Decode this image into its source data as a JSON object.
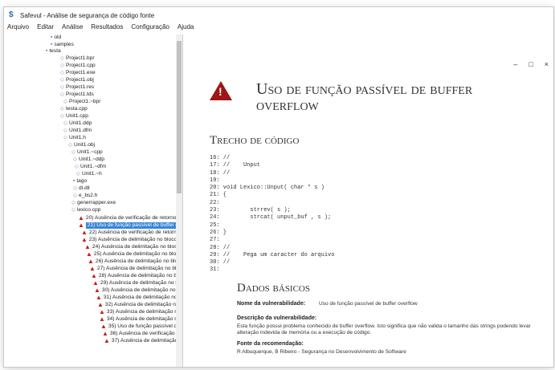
{
  "window": {
    "title": "Safevul - Análise de segurança de código fonte",
    "controls": {
      "minimize": "–",
      "maximize": "□",
      "close": "×"
    }
  },
  "menu": [
    "Arquivo",
    "Editar",
    "Análise",
    "Resultados",
    "Configuração",
    "Ajuda"
  ],
  "tree": [
    {
      "label": "old",
      "icon": "folder"
    },
    {
      "label": "samples",
      "icon": "folder"
    },
    {
      "label": "testa",
      "icon": "folder"
    },
    {
      "label": "Project1.bpr",
      "icon": "file"
    },
    {
      "label": "Project1.cpp",
      "icon": "file"
    },
    {
      "label": "Project1.exe",
      "icon": "file"
    },
    {
      "label": "Project1.obj",
      "icon": "file"
    },
    {
      "label": "Project1.res",
      "icon": "file"
    },
    {
      "label": "Project1.tds",
      "icon": "file"
    },
    {
      "label": "Project1.~bpr",
      "icon": "file"
    },
    {
      "label": "testa.cpp",
      "icon": "file"
    },
    {
      "label": "Unit1.cpp",
      "icon": "file"
    },
    {
      "label": "Unit1.ddp",
      "icon": "file"
    },
    {
      "label": "Unit1.dfm",
      "icon": "file"
    },
    {
      "label": "Unit1.h",
      "icon": "file"
    },
    {
      "label": "Unit1.obj",
      "icon": "file"
    },
    {
      "label": "Unit1.~cpp",
      "icon": "file"
    },
    {
      "label": "Unit1.~ddp",
      "icon": "file"
    },
    {
      "label": "Unit1.~dfm",
      "icon": "file"
    },
    {
      "label": "Unit1.~h",
      "icon": "file"
    },
    {
      "label": "tago",
      "icon": "folder"
    },
    {
      "label": "dl.dll",
      "icon": "file"
    },
    {
      "label": "e_bs2.h",
      "icon": "file"
    },
    {
      "label": "generrapper.exe",
      "icon": "file"
    },
    {
      "label": "lexico.cpp",
      "icon": "file"
    },
    {
      "label": "20) Ausência de verificação de retorno de função",
      "icon": "warn"
    },
    {
      "label": "21) Uso de função passível de buffer overflow",
      "icon": "warn",
      "selected": true
    },
    {
      "label": "22) Ausência de verificação de retorno de função",
      "icon": "warn"
    },
    {
      "label": "23) Ausência de delimitação no bloco de código",
      "icon": "warn"
    },
    {
      "label": "24) Ausência de delimitação no bloco de código",
      "icon": "warn"
    },
    {
      "label": "25) Ausência de delimitação no bloco de código",
      "icon": "warn"
    },
    {
      "label": "26) Ausência de delimitação no bloco de código",
      "icon": "warn"
    },
    {
      "label": "27) Ausência de delimitação no bloco de código",
      "icon": "warn"
    },
    {
      "label": "28) Ausência de delimitação no bloco de código",
      "icon": "warn"
    },
    {
      "label": "29) Ausência de delimitação no bloco de código",
      "icon": "warn"
    },
    {
      "label": "30) Ausência de delimitação no bloco de código",
      "icon": "warn"
    },
    {
      "label": "31) Ausência de delimitação no bloco de código",
      "icon": "warn"
    },
    {
      "label": "32) Ausência de delimitação no bloco de código",
      "icon": "warn"
    },
    {
      "label": "33) Ausência de delimitação no bloco de código",
      "icon": "warn"
    },
    {
      "label": "34) Ausência de delimitação no bloco de código",
      "icon": "warn"
    },
    {
      "label": "35) Uso de função passível de buffer overflow",
      "icon": "warn"
    },
    {
      "label": "36) Ausência de verificação de retorno de função",
      "icon": "warn"
    },
    {
      "label": "37) Ausência de delimitação no bloco de código",
      "icon": "warn"
    }
  ],
  "detail": {
    "title": "Uso de função passível de buffer overflow",
    "code_heading": "Trecho de código",
    "code": "16: //\n17: //    Unput\n18: //\n19:\n20: void Lexico::Unput( char * s )\n21: {\n22:\n23:         strrev( s );\n24:         strcat( unput_buf , s );\n25:\n26: }\n27:\n28: //\n29: //    Pega um caracter do arquivo\n30: //\n31:",
    "basic_heading": "Dados básicos",
    "name_label": "Nome da vulnerabilidade:",
    "name_value": "Uso de função passível de buffer overflow",
    "desc_label": "Descrição da vulnerabilidade:",
    "desc_value": "Esta função possui problema conhecido de buffer overflow. Isto significa que não valida o tamanho das strings podendo levar alteração indevida de memória ou a execução de código.",
    "source_label": "Fonte da recomendação:",
    "source_value": "R Albuquerque, B Ribeiro - Segurança no Desenvolvimento de Software"
  },
  "colors": {
    "warning": "#a01515",
    "selection": "#3a86d6"
  }
}
